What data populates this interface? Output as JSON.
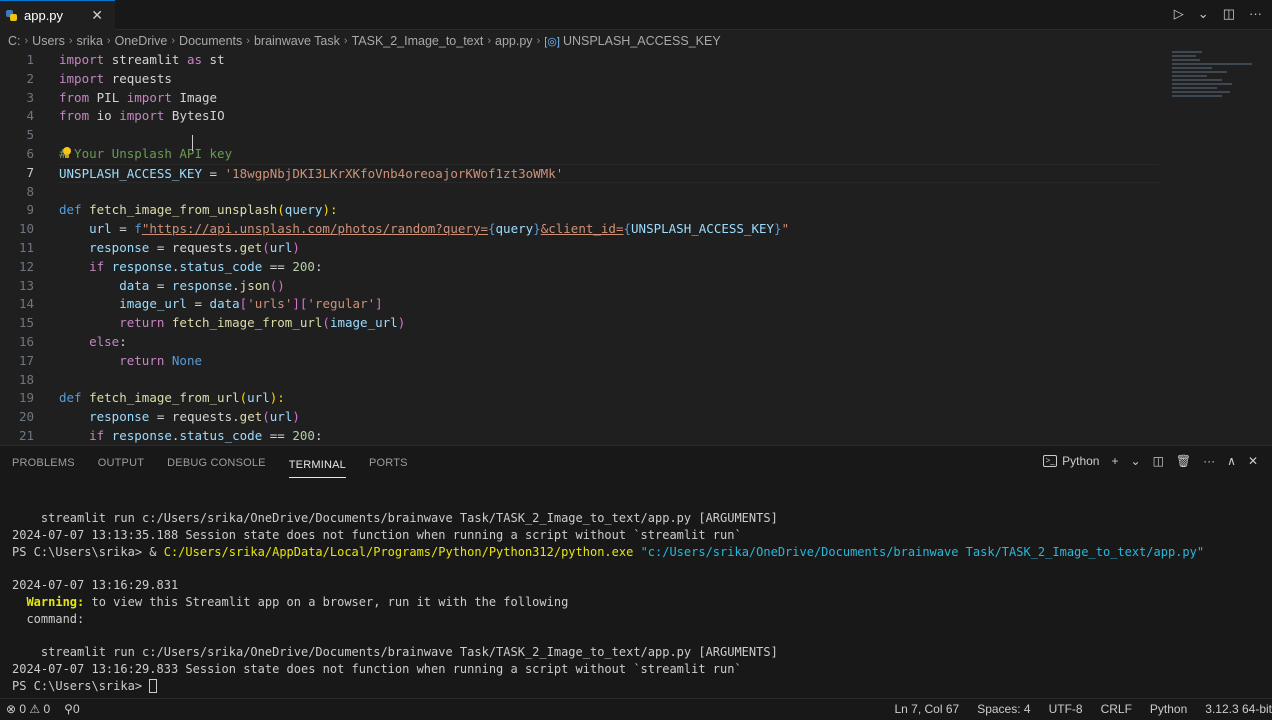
{
  "tab": {
    "label": "app.py",
    "close": "✕"
  },
  "tab_actions": {
    "run": "▷",
    "run_menu": "⌄",
    "split": "◫",
    "more": "···"
  },
  "breadcrumb": [
    "C:",
    "Users",
    "srika",
    "OneDrive",
    "Documents",
    "brainwave Task",
    "TASK_2_Image_to_text",
    "app.py",
    "UNSPLASH_ACCESS_KEY"
  ],
  "editor": {
    "line_numbers": [
      "1",
      "2",
      "3",
      "4",
      "5",
      "6",
      "7",
      "8",
      "9",
      "10",
      "11",
      "12",
      "13",
      "14",
      "15",
      "16",
      "17",
      "18",
      "19",
      "20",
      "21"
    ],
    "code": {
      "l1": [
        "import",
        "streamlit",
        "as",
        "st"
      ],
      "l2": [
        "import",
        "requests"
      ],
      "l3": [
        "from",
        "PIL",
        "import",
        "Image"
      ],
      "l4": [
        "from",
        "io",
        "import",
        "BytesIO"
      ],
      "l6": "# Your Unsplash API key",
      "l7": [
        "UNSPLASH_ACCESS_KEY",
        "=",
        "'18wgpNbjDKI3LKrXKfoVnb4oreoajorKWof1zt3oWMk'"
      ],
      "l9": [
        "def",
        "fetch_image_from_unsplash",
        "(",
        "query",
        "):"
      ],
      "l10": [
        "url",
        "=",
        "f",
        "\"https://api.unsplash.com/photos/random?query=",
        "{",
        "query",
        "}",
        "&client_id=",
        "{",
        "UNSPLASH_ACCESS_KEY",
        "}",
        "\""
      ],
      "l11": [
        "response",
        "=",
        "requests",
        ".",
        "get",
        "(",
        "url",
        ")"
      ],
      "l12": [
        "if",
        "response",
        ".",
        "status_code",
        "==",
        "200",
        ":"
      ],
      "l13": [
        "data",
        "=",
        "response",
        ".",
        "json",
        "()"
      ],
      "l14": [
        "image_url",
        "=",
        "data",
        "[",
        "'urls'",
        "][",
        "'regular'",
        "]"
      ],
      "l15": [
        "return",
        "fetch_image_from_url",
        "(",
        "image_url",
        ")"
      ],
      "l16": [
        "else",
        ":"
      ],
      "l17": [
        "return",
        "None"
      ],
      "l19": [
        "def",
        "fetch_image_from_url",
        "(",
        "url",
        "):"
      ],
      "l20": [
        "response",
        "=",
        "requests",
        ".",
        "get",
        "(",
        "url",
        ")"
      ],
      "l21": [
        "if",
        "response",
        ".",
        "status_code",
        "==",
        "200",
        ":"
      ]
    }
  },
  "panel": {
    "tabs": [
      "PROBLEMS",
      "OUTPUT",
      "DEBUG CONSOLE",
      "TERMINAL",
      "PORTS"
    ],
    "active_tab": "TERMINAL",
    "shell": "Python",
    "actions": {
      "add": "+",
      "add_menu": "⌄",
      "split": "◫",
      "trash": "🗑",
      "more": "···",
      "maximize": "∧",
      "close": "✕"
    }
  },
  "terminal": {
    "t1": "    streamlit run c:/Users/srika/OneDrive/Documents/brainwave Task/TASK_2_Image_to_text/app.py [ARGUMENTS]",
    "t2": "2024-07-07 13:13:35.188 Session state does not function when running a script without `streamlit run`",
    "t3_prompt": "PS C:\\Users\\srika> & ",
    "t3_exe": "C:/Users/srika/AppData/Local/Programs/Python/Python312/python.exe",
    "t3_arg": "\"c:/Users/srika/OneDrive/Documents/brainwave Task/TASK_2_Image_to_text/app.py\"",
    "t5": "2024-07-07 13:16:29.831",
    "t6_warn": "  Warning:",
    "t6_rest": " to view this Streamlit app on a browser, run it with the following",
    "t7": "  command:",
    "t9": "    streamlit run c:/Users/srika/OneDrive/Documents/brainwave Task/TASK_2_Image_to_text/app.py [ARGUMENTS]",
    "t10": "2024-07-07 13:16:29.833 Session state does not function when running a script without `streamlit run`",
    "t11": "PS C:\\Users\\srika> "
  },
  "statusbar": {
    "errors": "⊗ 0",
    "warnings": "⚠ 0",
    "ports": "⚲0",
    "position": "Ln 7, Col 67",
    "spaces": "Spaces: 4",
    "encoding": "UTF-8",
    "eol": "CRLF",
    "language": "Python",
    "interpreter": "3.12.3 64-bit"
  },
  "colors": {
    "accent": "#0078d4",
    "background": "#1f1f1f",
    "panel": "#181818"
  }
}
